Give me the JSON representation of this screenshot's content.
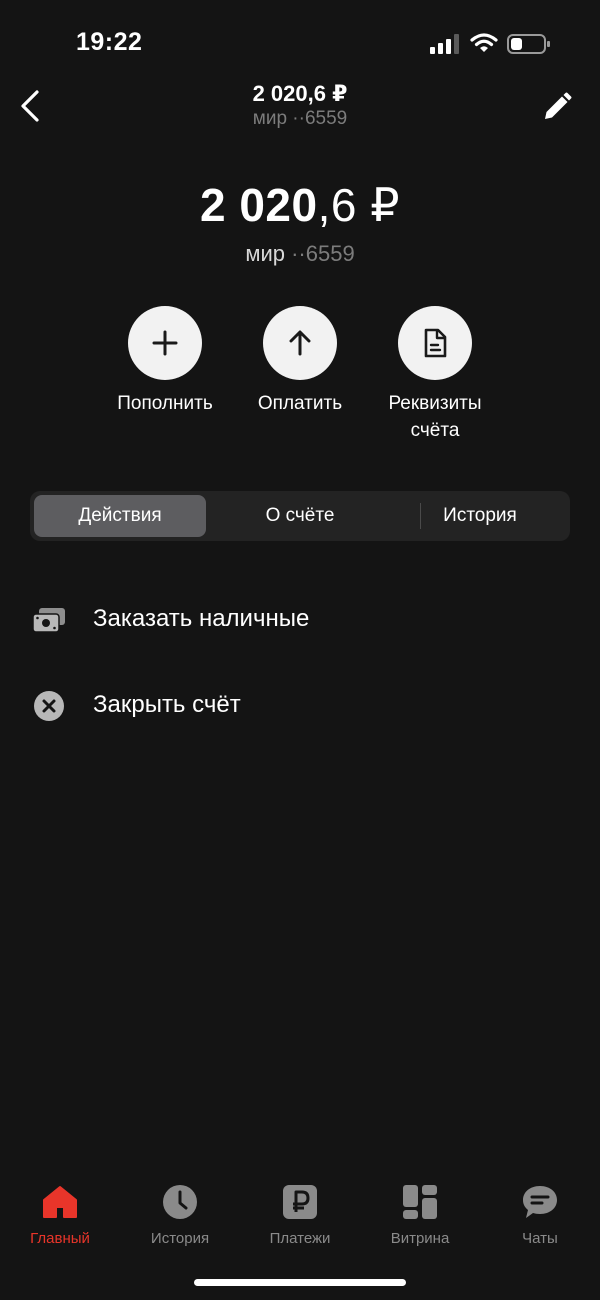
{
  "status_bar": {
    "time": "19:22"
  },
  "header": {
    "title": "2 020,6 ₽",
    "subtitle": "мир ··6559"
  },
  "balance": {
    "integer": "2 020",
    "fraction": ",6 ₽",
    "card_label": "мир",
    "card_number": "··6559"
  },
  "actions": [
    {
      "icon": "plus-icon",
      "label": "Пополнить"
    },
    {
      "icon": "arrow-up-icon",
      "label": "Оплатить"
    },
    {
      "icon": "document-icon",
      "label_line1": "Реквизиты",
      "label_line2": "счёта"
    }
  ],
  "tabs": [
    {
      "label": "Действия",
      "active": true
    },
    {
      "label": "О счёте",
      "active": false
    },
    {
      "label": "История",
      "active": false
    }
  ],
  "list": [
    {
      "icon": "cash-icon",
      "label": "Заказать наличные"
    },
    {
      "icon": "close-circle-icon",
      "label": "Закрыть счёт"
    }
  ],
  "bottom_nav": [
    {
      "icon": "home-icon",
      "label": "Главный",
      "active": true
    },
    {
      "icon": "clock-icon",
      "label": "История",
      "active": false
    },
    {
      "icon": "ruble-icon",
      "label": "Платежи",
      "active": false
    },
    {
      "icon": "showcase-icon",
      "label": "Витрина",
      "active": false
    },
    {
      "icon": "chat-icon",
      "label": "Чаты",
      "active": false
    }
  ],
  "colors": {
    "background": "#141414",
    "accent": "#e8352a",
    "muted": "#7c7c7c",
    "tab_active": "#5d5d60"
  }
}
